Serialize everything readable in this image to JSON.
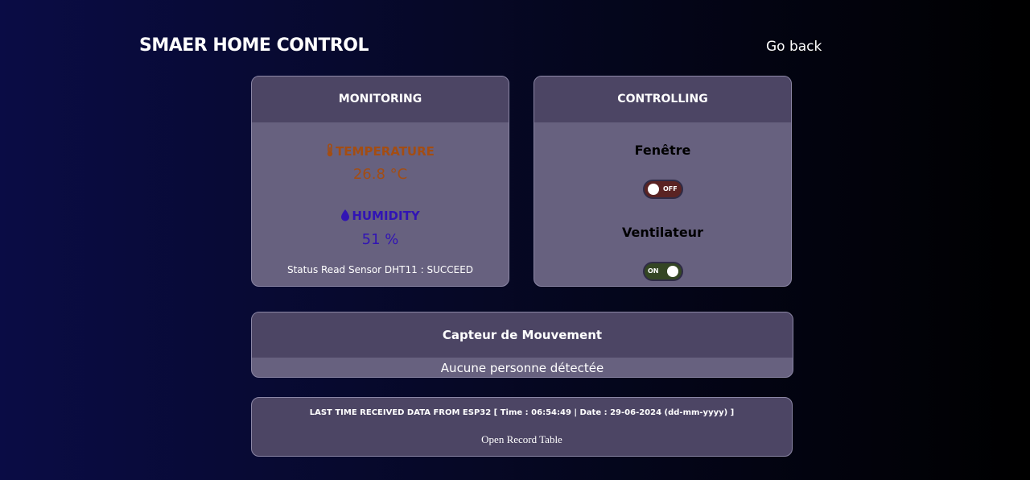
{
  "header": {
    "title": "SMAER HOME CONTROL",
    "go_back": "Go back"
  },
  "monitoring": {
    "title": "MONITORING",
    "temperature": {
      "label": "TEMPERATURE",
      "value": "26.8 °C",
      "icon": "thermometer-icon",
      "color": "#a34d13"
    },
    "humidity": {
      "label": "HUMIDITY",
      "value": "51 %",
      "icon": "droplet-icon",
      "color": "#3114b4"
    },
    "status": "Status Read Sensor DHT11 : SUCCEED"
  },
  "controlling": {
    "title": "CONTROLLING",
    "fenetre": {
      "label": "Fenêtre",
      "state": "OFF"
    },
    "ventilateur": {
      "label": "Ventilateur",
      "state": "ON"
    }
  },
  "motion": {
    "title": "Capteur de Mouvement",
    "status": "Aucune personne détectée"
  },
  "last_data": {
    "text": "LAST TIME RECEIVED DATA FROM ESP32 [ Time : 06:54:49 | Date : 29-06-2024 (dd-mm-yyyy) ]",
    "link": "Open Record Table"
  },
  "colors": {
    "card_header": "#4c4564",
    "card_body": "#67617f",
    "switch_off": "#5a2323",
    "switch_on": "#344624"
  }
}
